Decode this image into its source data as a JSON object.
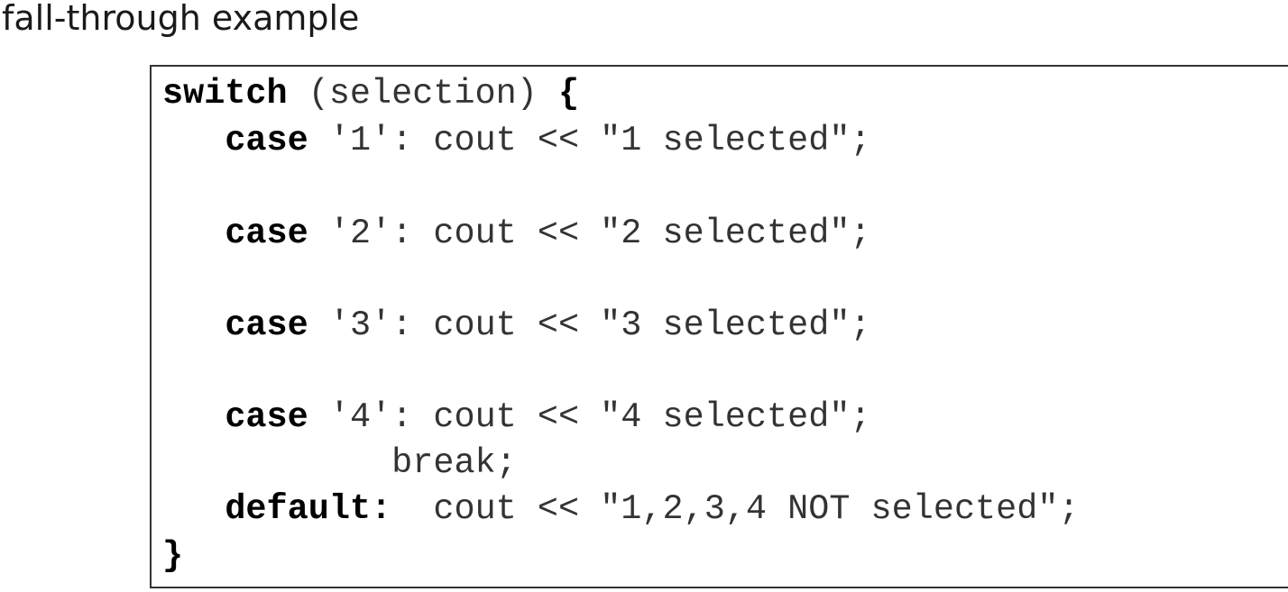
{
  "title": "fall-through example",
  "code": {
    "line1": {
      "kw": "switch",
      "rest": " (selection) ",
      "brace": "{"
    },
    "line2": {
      "indent": "   ",
      "kw": "case",
      "rest": " '1': cout << \"1 selected\";"
    },
    "line3": {
      "indent": "   ",
      "kw": "case",
      "rest": " '2': cout << \"2 selected\";"
    },
    "line4": {
      "indent": "   ",
      "kw": "case",
      "rest": " '3': cout << \"3 selected\";"
    },
    "line5": {
      "indent": "   ",
      "kw": "case",
      "rest": " '4': cout << \"4 selected\";"
    },
    "line6": {
      "text": "           break;"
    },
    "line7": {
      "indent": "   ",
      "kw": "default:",
      "rest": "  cout << \"1,2,3,4 NOT selected\";"
    },
    "line8": {
      "brace": "}"
    }
  }
}
